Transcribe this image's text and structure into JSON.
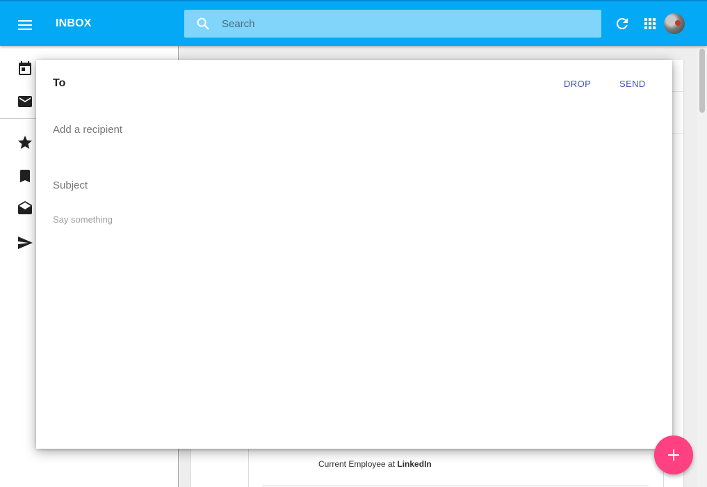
{
  "header": {
    "title": "INBOX",
    "search_placeholder": "Search",
    "icons": [
      "menu-icon",
      "search-icon",
      "refresh-icon",
      "apps-icon",
      "avatar"
    ],
    "color": "#03a9f4"
  },
  "sidebar": {
    "icons": [
      "calendar-icon",
      "mail-icon",
      "star-icon",
      "bookmark-icon",
      "drafts-icon",
      "send-icon"
    ]
  },
  "background_content": {
    "snippet_prefix": "Current Employee at ",
    "snippet_company": "LinkedIn"
  },
  "compose": {
    "to_label": "To",
    "drop_label": "DROP",
    "send_label": "SEND",
    "recipient_placeholder": "Add a recipient",
    "subject_placeholder": "Subject",
    "body_placeholder": "Say something",
    "accent_color": "#3f51b5"
  },
  "fab": {
    "icon": "plus-icon",
    "color": "#ff4081"
  }
}
